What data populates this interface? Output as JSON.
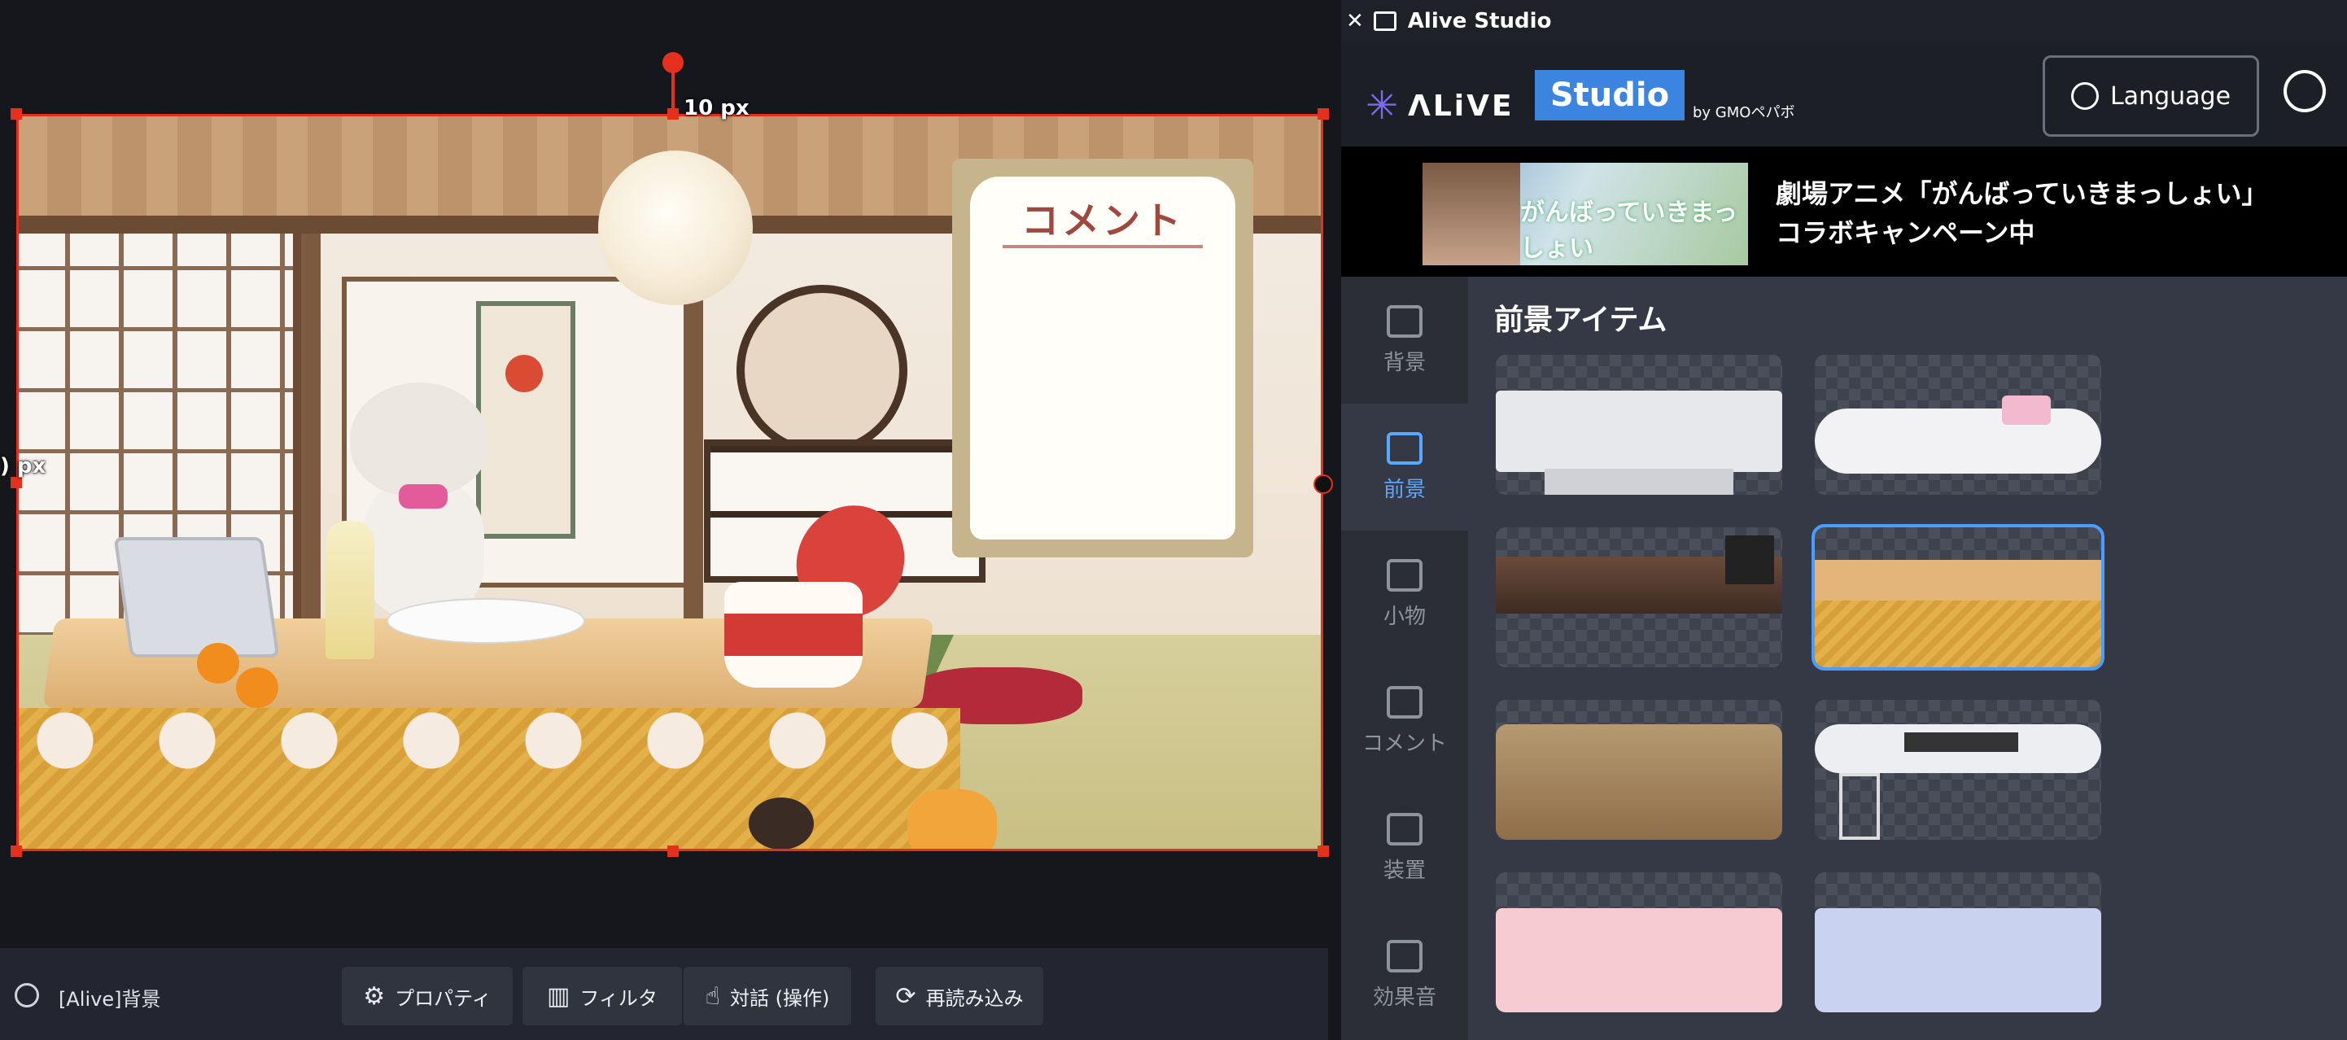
{
  "preview": {
    "offset_top": "10 px",
    "offset_left": ") px",
    "comment_title": "コメント"
  },
  "bottom_bar": {
    "source_name": "[Alive]背景",
    "buttons": [
      {
        "label": "プロパティ",
        "icon": "gear-icon"
      },
      {
        "label": "フィルタ",
        "icon": "filter-icon"
      },
      {
        "label": "対話 (操作)",
        "icon": "pointer-icon"
      },
      {
        "label": "再読み込み",
        "icon": "reload-icon"
      }
    ]
  },
  "dock": {
    "title": "Alive Studio",
    "logo_alive": "ΛLiVE",
    "logo_studio": "Studio",
    "logo_by": "by GMOペパボ",
    "language_label": "Language",
    "banner_caption": "がんばっていきまっしょい",
    "banner_line1": "劇場アニメ「がんばっていきまっしょい」",
    "banner_line2": "コラボキャンペーン中"
  },
  "sidenav": [
    {
      "label": "背景",
      "icon": "image-icon",
      "active": false
    },
    {
      "label": "前景",
      "icon": "image-add-icon",
      "active": true
    },
    {
      "label": "小物",
      "icon": "cup-icon",
      "active": false
    },
    {
      "label": "コメント",
      "icon": "comment-icon",
      "active": false
    },
    {
      "label": "装置",
      "icon": "widgets-icon",
      "active": false
    },
    {
      "label": "効果音",
      "icon": "music-note-icon",
      "active": false
    }
  ],
  "content": {
    "section_title": "前景アイテム",
    "items": [
      {
        "theme": "white-desk-owl",
        "selected": false
      },
      {
        "theme": "white-round-table-bunny",
        "selected": false
      },
      {
        "theme": "dark-wood-desk",
        "selected": false
      },
      {
        "theme": "kotatsu-cat",
        "selected": true
      },
      {
        "theme": "kotatsu-dogs",
        "selected": false
      },
      {
        "theme": "white-gaming-desk",
        "selected": false
      },
      {
        "theme": "pink-desk",
        "selected": false
      },
      {
        "theme": "blue-desk",
        "selected": false
      }
    ]
  },
  "colors": {
    "selection": "#e6301e",
    "accent": "#5aa7ff",
    "studio_blue": "#3b84e0"
  }
}
